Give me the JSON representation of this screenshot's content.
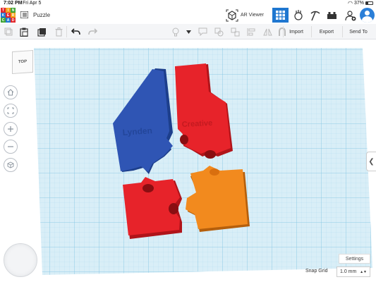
{
  "status_bar": {
    "time": "7:02 PM",
    "date": "Fri Apr 5",
    "battery": "37%"
  },
  "header": {
    "logo_letters": [
      "T",
      "I",
      "N",
      "K",
      "E",
      "R",
      "C",
      "A",
      "D"
    ],
    "logo_colors": [
      "#e2262b",
      "#f2a11c",
      "#3fa535",
      "#1f77d0",
      "#e2262b",
      "#f2a11c",
      "#3fa535",
      "#1f77d0",
      "#e2262b"
    ],
    "title": "Puzzle",
    "ar_viewer_label": "AR Viewer"
  },
  "toolbar": {
    "import_label": "Import",
    "export_label": "Export",
    "send_to_label": "Send To"
  },
  "workplane": {
    "viewcube_label": "TOP",
    "settings_label": "Settings",
    "snap_grid_label": "Snap Grid",
    "snap_grid_value": "1.0 mm",
    "grid_color": "#a9d8ee",
    "grid_background": "#d9eef7",
    "piece_colors": {
      "blue": "#2f55b4",
      "red": "#e7232a",
      "orange": "#f28a1e"
    },
    "engraved_text": {
      "blue_piece": "Lynden",
      "red_piece": "Creative"
    }
  },
  "colors": {
    "accent": "#1f77d0"
  }
}
